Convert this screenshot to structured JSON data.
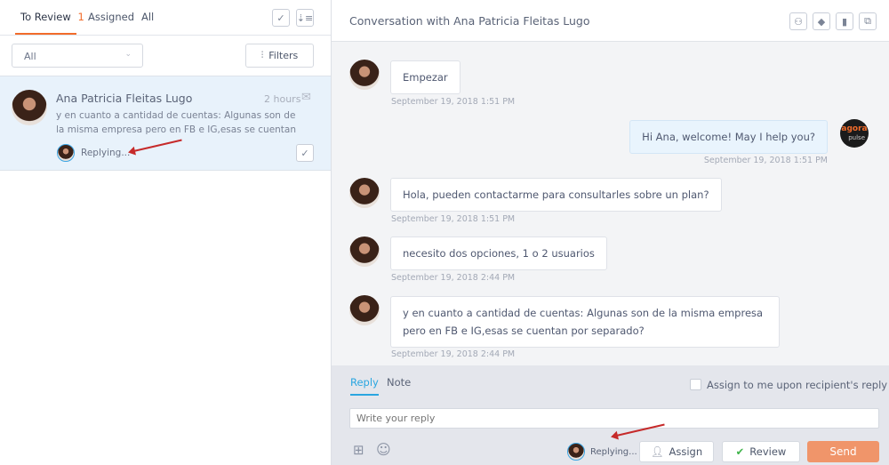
{
  "left_panel": {
    "tabs": [
      {
        "label": "To Review",
        "count": "1",
        "active": true
      },
      {
        "label": "Assigned"
      },
      {
        "label": "All"
      }
    ],
    "filter_select": {
      "value": "All"
    },
    "filters_button": "Filters",
    "conversation": {
      "name": "Ana Patricia Fleitas Lugo",
      "time": "2 hours",
      "preview": "y en cuanto a cantidad de cuentas: Algunas son de la misma empresa pero en FB e IG,esas se cuentan por",
      "status": "Replying..."
    }
  },
  "right_panel": {
    "title": "Conversation with Ana Patricia Fleitas Lugo",
    "header_icons": [
      "assign-user-icon",
      "tag-icon",
      "bookmark-icon",
      "expand-icon"
    ],
    "messages": [
      {
        "from": "contact",
        "text": "Empezar",
        "time": "September 19, 2018 1:51 PM"
      },
      {
        "from": "agent",
        "text": "Hi Ana, welcome! May I help you?",
        "time": "September 19, 2018 1:51 PM"
      },
      {
        "from": "contact",
        "text": "Hola, pueden contactarme para consultarles sobre un plan?",
        "time": "September 19, 2018 1:51 PM"
      },
      {
        "from": "contact",
        "text": "necesito dos opciones, 1 o 2 usuarios",
        "time": "September 19, 2018 2:44 PM"
      },
      {
        "from": "contact",
        "text": "y en cuanto a cantidad de cuentas: Algunas son de la misma empresa pero en FB e IG,esas se cuentan por separado?",
        "time": "September 19, 2018 2:44 PM"
      }
    ],
    "agent_logo": {
      "line1": "agora",
      "line2": "pulse"
    },
    "composer": {
      "tabs": [
        "Reply",
        "Note"
      ],
      "assign_checkbox_label": "Assign to me upon recipient's reply",
      "reply_placeholder": "Write your reply",
      "status": "Replying...",
      "assign_button": "Assign",
      "review_button": "Review",
      "send_button": "Send"
    }
  },
  "colors": {
    "accent": "#f26c2b",
    "send": "#f0956a",
    "reply_tab": "#2aa6e0",
    "selected_row": "#e8f2fb"
  }
}
